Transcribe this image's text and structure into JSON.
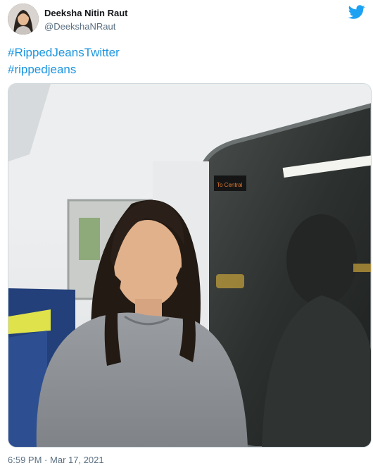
{
  "tweet": {
    "author_name": "Deeksha Nitin Raut",
    "author_handle": "@DeekshaNRaut",
    "hashtags": [
      "#RippedJeansTwitter",
      "#rippedjeans"
    ],
    "timestamp": "6:59 PM",
    "separator": "·",
    "date": "Mar 17, 2021"
  },
  "media": {
    "train_sign_text": "To Central"
  },
  "icons": {
    "platform": "twitter-bird-icon"
  },
  "colors": {
    "link": "#1b95e0",
    "brand": "#1da1f2",
    "muted": "#5b7083"
  }
}
